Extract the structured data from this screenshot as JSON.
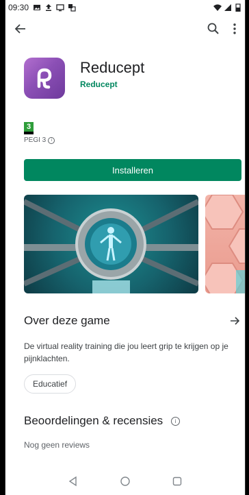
{
  "statusbar": {
    "time": "09:30",
    "icons": [
      "image-icon",
      "upload-icon",
      "cast-icon",
      "screenshot-icon"
    ],
    "right_icons": [
      "wifi-icon",
      "signal-icon",
      "battery-icon"
    ]
  },
  "appbar": {
    "icons": [
      "back-arrow-icon",
      "search-icon",
      "more-vert-icon"
    ]
  },
  "app": {
    "name": "Reducept",
    "developer": "Reducept",
    "icon_color": "#8b4fb5"
  },
  "pegi": {
    "rating": "3",
    "label": "PEGI 3",
    "badge_color": "#2e9d3a"
  },
  "install": {
    "label": "Installeren",
    "color": "#01875f"
  },
  "about": {
    "title": "Over deze game",
    "description": "De virtual reality training die jou leert grip te krijgen op je pijnklachten.",
    "chip": "Educatief"
  },
  "ratings": {
    "title": "Beoordelingen & recensies",
    "empty": "Nog geen reviews"
  },
  "navbar": {
    "icons": [
      "nav-back-icon",
      "nav-home-icon",
      "nav-recents-icon"
    ]
  }
}
